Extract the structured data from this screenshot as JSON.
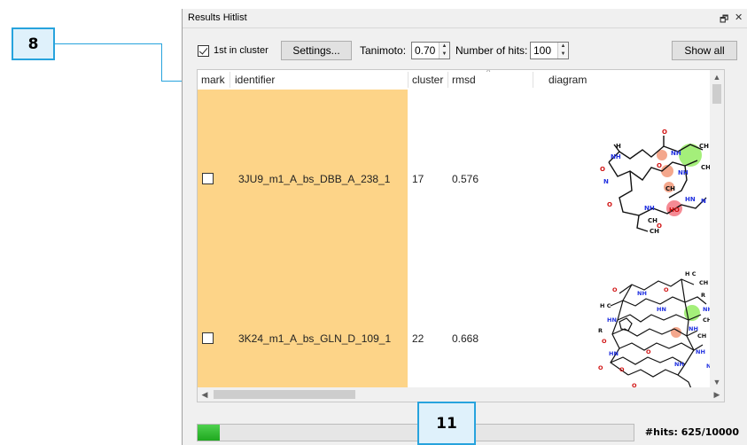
{
  "callouts": {
    "left": "8",
    "bottom": "11"
  },
  "panel": {
    "title": "Results Hitlist",
    "float_icon": "restore-icon",
    "close_icon": "close-icon",
    "float_glyph": "🗗",
    "close_glyph": "✕"
  },
  "toolbar": {
    "first_in_cluster_label": "1st in cluster",
    "first_in_cluster_checked": true,
    "settings_label": "Settings...",
    "tanimoto_label": "Tanimoto:",
    "tanimoto_value": "0.70",
    "hits_label": "Number of hits:",
    "hits_value": "100",
    "show_all_label": "Show all"
  },
  "table": {
    "columns": [
      "mark",
      "identifier",
      "cluster",
      "rmsd",
      "diagram"
    ],
    "rows": [
      {
        "identifier": "3JU9_m1_A_bs_DBB_A_238_1",
        "cluster": "17",
        "rmsd": "0.576"
      },
      {
        "identifier": "3K24_m1_A_bs_GLN_D_109_1",
        "cluster": "22",
        "rmsd": "0.668"
      }
    ]
  },
  "status": {
    "progress_fraction": 0.05,
    "hits_text": "#hits: 625/10000"
  },
  "colors": {
    "highlight_row": "#fdd488",
    "callout_border": "#27a3dd",
    "callout_fill": "#dff1fb",
    "progress": "#2fb82f"
  }
}
